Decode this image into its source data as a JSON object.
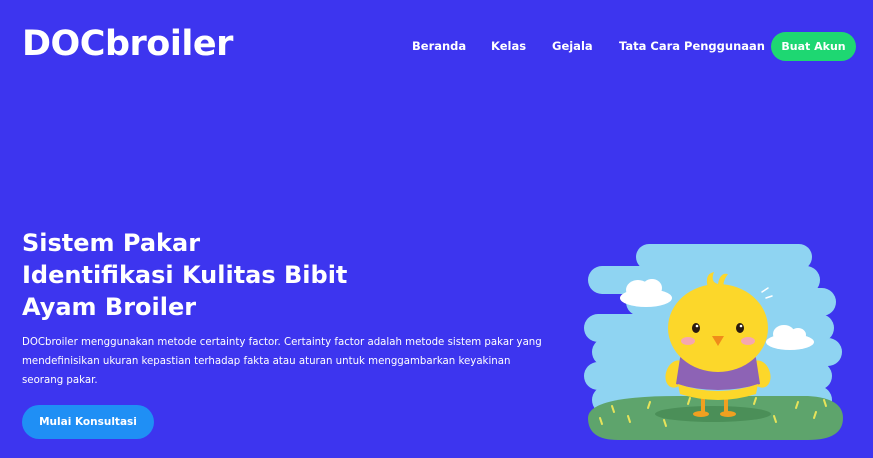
{
  "brand": {
    "logo": "DOCbroiler"
  },
  "nav": {
    "items": [
      "Beranda",
      "Kelas",
      "Gejala",
      "Tata Cara Penggunaan"
    ],
    "cta": "Buat Akun"
  },
  "hero": {
    "title_lines": [
      "Sistem Pakar",
      "Identifikasi Kulitas Bibit",
      "Ayam Broiler"
    ],
    "description": "DOCbroiler menggunakan metode certainty factor. Certainty factor adalah metode sistem pakar yang mendefinisikan ukuran kepastian terhadap fakta atau aturan untuk menggambarkan keyakinan seorang pakar.",
    "button": "Mulai Konsultasi"
  },
  "colors": {
    "background": "#3d35ef",
    "cta_green": "#1ed772",
    "button_blue": "#1f8ff5",
    "sky": "#8fd4f2",
    "chick": "#fcd72a",
    "shirt": "#8d63b5",
    "grass": "#5ea46c"
  },
  "illustration": {
    "icon": "chick-mascot-icon"
  }
}
